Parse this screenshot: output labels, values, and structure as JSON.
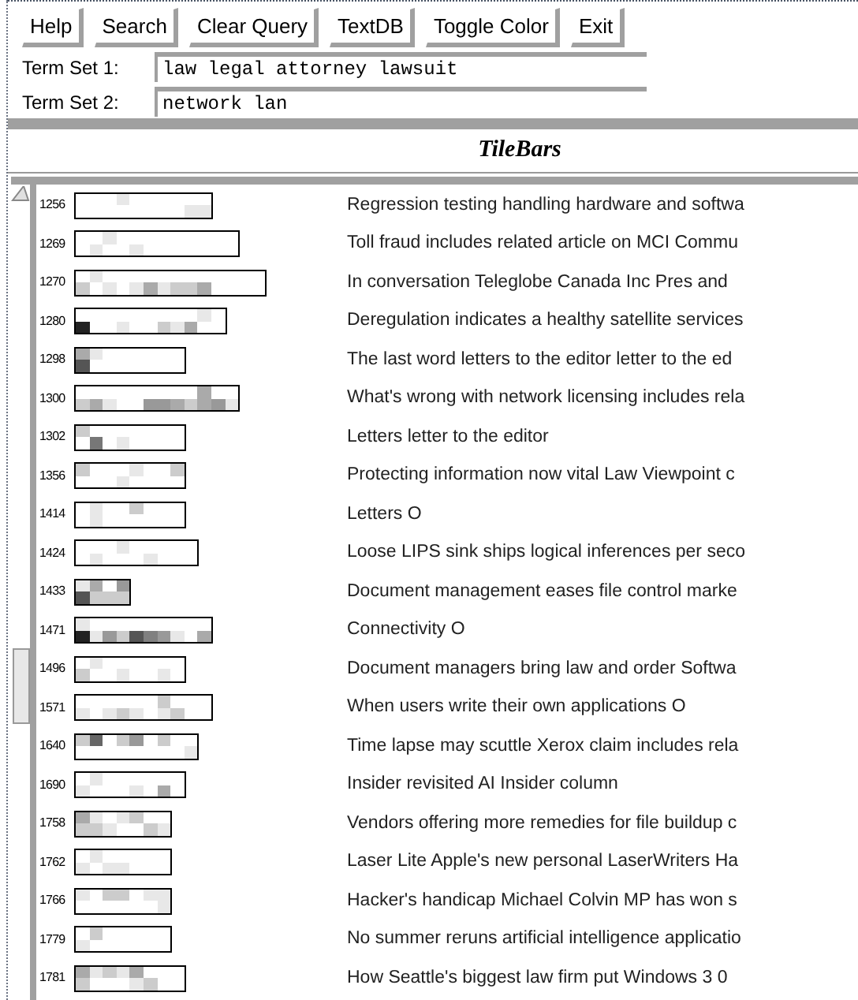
{
  "toolbar": {
    "buttons": [
      "Help",
      "Search",
      "Clear Query",
      "TextDB",
      "Toggle Color",
      "Exit"
    ]
  },
  "query": [
    {
      "label": "Term Set 1:",
      "value": "law legal attorney lawsuit"
    },
    {
      "label": "Term Set 2:",
      "value": "network lan"
    }
  ],
  "panel_title": "TileBars",
  "docs": [
    {
      "id": "1256",
      "title": "Regression testing handling hardware and softwa",
      "tiles": [
        [
          {
            "color": "#ffffff"
          },
          {
            "color": "#ffffff"
          },
          {
            "color": "#ffffff"
          },
          {
            "color": "#e8e8e8"
          },
          {
            "color": "#ffffff"
          },
          {
            "color": "#ffffff"
          },
          {
            "color": "#ffffff"
          },
          {
            "color": "#ffffff"
          },
          {
            "color": "#ffffff"
          },
          {
            "color": "#ffffff"
          }
        ],
        [
          {
            "color": "#ffffff"
          },
          {
            "color": "#ffffff"
          },
          {
            "color": "#ffffff"
          },
          {
            "color": "#ffffff"
          },
          {
            "color": "#ffffff"
          },
          {
            "color": "#ffffff"
          },
          {
            "color": "#ffffff"
          },
          {
            "color": "#ffffff"
          },
          {
            "color": "#e8e8e8"
          },
          {
            "color": "#e8e8e8"
          }
        ]
      ]
    },
    {
      "id": "1269",
      "title": "Toll fraud includes related article on MCI Commu",
      "tiles": [
        [
          {
            "color": "#ffffff"
          },
          {
            "color": "#ffffff"
          },
          {
            "color": "#e8e8e8"
          },
          {
            "color": "#ffffff"
          },
          {
            "color": "#ffffff"
          },
          {
            "color": "#ffffff"
          },
          {
            "color": "#ffffff"
          },
          {
            "color": "#ffffff"
          },
          {
            "color": "#ffffff"
          },
          {
            "color": "#ffffff"
          },
          {
            "color": "#ffffff"
          },
          {
            "color": "#ffffff"
          }
        ],
        [
          {
            "color": "#ffffff"
          },
          {
            "color": "#e8e8e8"
          },
          {
            "color": "#ffffff"
          },
          {
            "color": "#ffffff"
          },
          {
            "color": "#e8e8e8"
          },
          {
            "color": "#ffffff"
          },
          {
            "color": "#ffffff"
          },
          {
            "color": "#ffffff"
          },
          {
            "color": "#ffffff"
          },
          {
            "color": "#ffffff"
          },
          {
            "color": "#ffffff"
          },
          {
            "color": "#ffffff"
          }
        ]
      ]
    },
    {
      "id": "1270",
      "title": "In conversation Teleglobe Canada Inc Pres and",
      "tiles": [
        [
          {
            "color": "#ffffff"
          },
          {
            "color": "#e8e8e8"
          },
          {
            "color": "#ffffff"
          },
          {
            "color": "#ffffff"
          },
          {
            "color": "#ffffff"
          },
          {
            "color": "#ffffff"
          },
          {
            "color": "#ffffff"
          },
          {
            "color": "#ffffff"
          },
          {
            "color": "#ffffff"
          },
          {
            "color": "#ffffff"
          },
          {
            "color": "#ffffff"
          },
          {
            "color": "#ffffff"
          },
          {
            "color": "#ffffff"
          },
          {
            "color": "#ffffff"
          }
        ],
        [
          {
            "color": "#cccccc"
          },
          {
            "color": "#ffffff"
          },
          {
            "color": "#e8e8e8"
          },
          {
            "color": "#ffffff"
          },
          {
            "color": "#e8e8e8"
          },
          {
            "color": "#aaaaaa"
          },
          {
            "color": "#e8e8e8"
          },
          {
            "color": "#cccccc"
          },
          {
            "color": "#cccccc"
          },
          {
            "color": "#aaaaaa"
          },
          {
            "color": "#ffffff"
          },
          {
            "color": "#ffffff"
          },
          {
            "color": "#ffffff"
          },
          {
            "color": "#ffffff"
          }
        ]
      ]
    },
    {
      "id": "1280",
      "title": "Deregulation indicates a healthy satellite services",
      "tiles": [
        [
          {
            "color": "#ffffff"
          },
          {
            "color": "#ffffff"
          },
          {
            "color": "#ffffff"
          },
          {
            "color": "#ffffff"
          },
          {
            "color": "#ffffff"
          },
          {
            "color": "#ffffff"
          },
          {
            "color": "#ffffff"
          },
          {
            "color": "#ffffff"
          },
          {
            "color": "#ffffff"
          },
          {
            "color": "#e8e8e8"
          },
          {
            "color": "#ffffff"
          }
        ],
        [
          {
            "color": "#222222"
          },
          {
            "color": "#ffffff"
          },
          {
            "color": "#ffffff"
          },
          {
            "color": "#e8e8e8"
          },
          {
            "color": "#ffffff"
          },
          {
            "color": "#ffffff"
          },
          {
            "color": "#cccccc"
          },
          {
            "color": "#e8e8e8"
          },
          {
            "color": "#aaaaaa"
          },
          {
            "color": "#ffffff"
          },
          {
            "color": "#ffffff"
          }
        ]
      ]
    },
    {
      "id": "1298",
      "title": "The last word letters to the editor letter to the ed",
      "tiles": [
        [
          {
            "color": "#aaaaaa"
          },
          {
            "color": "#e8e8e8"
          },
          {
            "color": "#ffffff"
          },
          {
            "color": "#ffffff"
          },
          {
            "color": "#ffffff"
          },
          {
            "color": "#ffffff"
          },
          {
            "color": "#ffffff"
          },
          {
            "color": "#ffffff"
          }
        ],
        [
          {
            "color": "#555555"
          },
          {
            "color": "#ffffff"
          },
          {
            "color": "#ffffff"
          },
          {
            "color": "#ffffff"
          },
          {
            "color": "#ffffff"
          },
          {
            "color": "#ffffff"
          },
          {
            "color": "#ffffff"
          },
          {
            "color": "#ffffff"
          }
        ]
      ]
    },
    {
      "id": "1300",
      "title": "What's wrong with network licensing includes rela",
      "tiles": [
        [
          {
            "color": "#ffffff"
          },
          {
            "color": "#ffffff"
          },
          {
            "color": "#ffffff"
          },
          {
            "color": "#ffffff"
          },
          {
            "color": "#ffffff"
          },
          {
            "color": "#ffffff"
          },
          {
            "color": "#ffffff"
          },
          {
            "color": "#ffffff"
          },
          {
            "color": "#ffffff"
          },
          {
            "color": "#aaaaaa"
          },
          {
            "color": "#ffffff"
          },
          {
            "color": "#ffffff"
          }
        ],
        [
          {
            "color": "#cccccc"
          },
          {
            "color": "#aaaaaa"
          },
          {
            "color": "#e8e8e8"
          },
          {
            "color": "#ffffff"
          },
          {
            "color": "#ffffff"
          },
          {
            "color": "#999999"
          },
          {
            "color": "#999999"
          },
          {
            "color": "#aaaaaa"
          },
          {
            "color": "#cccccc"
          },
          {
            "color": "#aaaaaa"
          },
          {
            "color": "#999999"
          },
          {
            "color": "#e8e8e8"
          }
        ]
      ]
    },
    {
      "id": "1302",
      "title": "Letters letter to the editor",
      "tiles": [
        [
          {
            "color": "#cccccc"
          },
          {
            "color": "#ffffff"
          },
          {
            "color": "#ffffff"
          },
          {
            "color": "#ffffff"
          },
          {
            "color": "#ffffff"
          },
          {
            "color": "#ffffff"
          },
          {
            "color": "#ffffff"
          },
          {
            "color": "#ffffff"
          }
        ],
        [
          {
            "color": "#ffffff"
          },
          {
            "color": "#777777"
          },
          {
            "color": "#ffffff"
          },
          {
            "color": "#e8e8e8"
          },
          {
            "color": "#ffffff"
          },
          {
            "color": "#ffffff"
          },
          {
            "color": "#ffffff"
          },
          {
            "color": "#ffffff"
          }
        ]
      ]
    },
    {
      "id": "1356",
      "title": "Protecting information now vital Law Viewpoint c",
      "tiles": [
        [
          {
            "color": "#cccccc"
          },
          {
            "color": "#ffffff"
          },
          {
            "color": "#ffffff"
          },
          {
            "color": "#ffffff"
          },
          {
            "color": "#e8e8e8"
          },
          {
            "color": "#ffffff"
          },
          {
            "color": "#ffffff"
          },
          {
            "color": "#cccccc"
          }
        ],
        [
          {
            "color": "#ffffff"
          },
          {
            "color": "#ffffff"
          },
          {
            "color": "#ffffff"
          },
          {
            "color": "#e8e8e8"
          },
          {
            "color": "#ffffff"
          },
          {
            "color": "#ffffff"
          },
          {
            "color": "#ffffff"
          },
          {
            "color": "#ffffff"
          }
        ]
      ]
    },
    {
      "id": "1414",
      "title": "Letters O",
      "tiles": [
        [
          {
            "color": "#ffffff"
          },
          {
            "color": "#e8e8e8"
          },
          {
            "color": "#ffffff"
          },
          {
            "color": "#ffffff"
          },
          {
            "color": "#cccccc"
          },
          {
            "color": "#ffffff"
          },
          {
            "color": "#ffffff"
          },
          {
            "color": "#ffffff"
          }
        ],
        [
          {
            "color": "#ffffff"
          },
          {
            "color": "#e8e8e8"
          },
          {
            "color": "#ffffff"
          },
          {
            "color": "#ffffff"
          },
          {
            "color": "#ffffff"
          },
          {
            "color": "#ffffff"
          },
          {
            "color": "#ffffff"
          },
          {
            "color": "#ffffff"
          }
        ]
      ]
    },
    {
      "id": "1424",
      "title": "Loose LIPS sink ships logical inferences per seco",
      "tiles": [
        [
          {
            "color": "#ffffff"
          },
          {
            "color": "#ffffff"
          },
          {
            "color": "#ffffff"
          },
          {
            "color": "#e8e8e8"
          },
          {
            "color": "#ffffff"
          },
          {
            "color": "#ffffff"
          },
          {
            "color": "#ffffff"
          },
          {
            "color": "#ffffff"
          },
          {
            "color": "#ffffff"
          }
        ],
        [
          {
            "color": "#ffffff"
          },
          {
            "color": "#e8e8e8"
          },
          {
            "color": "#ffffff"
          },
          {
            "color": "#ffffff"
          },
          {
            "color": "#ffffff"
          },
          {
            "color": "#e8e8e8"
          },
          {
            "color": "#ffffff"
          },
          {
            "color": "#ffffff"
          },
          {
            "color": "#ffffff"
          }
        ]
      ]
    },
    {
      "id": "1433",
      "title": "Document management eases file control marke",
      "tiles": [
        [
          {
            "color": "#e8e8e8"
          },
          {
            "color": "#aaaaaa"
          },
          {
            "color": "#ffffff"
          },
          {
            "color": "#999999"
          }
        ],
        [
          {
            "color": "#555555"
          },
          {
            "color": "#cccccc"
          },
          {
            "color": "#cccccc"
          },
          {
            "color": "#cccccc"
          }
        ]
      ]
    },
    {
      "id": "1471",
      "title": "Connectivity O",
      "tiles": [
        [
          {
            "color": "#e8e8e8"
          },
          {
            "color": "#ffffff"
          },
          {
            "color": "#ffffff"
          },
          {
            "color": "#ffffff"
          },
          {
            "color": "#ffffff"
          },
          {
            "color": "#ffffff"
          },
          {
            "color": "#ffffff"
          },
          {
            "color": "#ffffff"
          },
          {
            "color": "#ffffff"
          },
          {
            "color": "#ffffff"
          }
        ],
        [
          {
            "color": "#222222"
          },
          {
            "color": "#e8e8e8"
          },
          {
            "color": "#999999"
          },
          {
            "color": "#cccccc"
          },
          {
            "color": "#555555"
          },
          {
            "color": "#808080"
          },
          {
            "color": "#999999"
          },
          {
            "color": "#e8e8e8"
          },
          {
            "color": "#ffffff"
          },
          {
            "color": "#aaaaaa"
          }
        ]
      ]
    },
    {
      "id": "1496",
      "title": "Document managers bring law and order Softwa",
      "tiles": [
        [
          {
            "color": "#ffffff"
          },
          {
            "color": "#e8e8e8"
          },
          {
            "color": "#ffffff"
          },
          {
            "color": "#ffffff"
          },
          {
            "color": "#ffffff"
          },
          {
            "color": "#ffffff"
          },
          {
            "color": "#ffffff"
          },
          {
            "color": "#ffffff"
          }
        ],
        [
          {
            "color": "#cccccc"
          },
          {
            "color": "#ffffff"
          },
          {
            "color": "#ffffff"
          },
          {
            "color": "#e8e8e8"
          },
          {
            "color": "#ffffff"
          },
          {
            "color": "#ffffff"
          },
          {
            "color": "#e8e8e8"
          },
          {
            "color": "#ffffff"
          }
        ]
      ]
    },
    {
      "id": "1571",
      "title": "When users write their own applications O",
      "tiles": [
        [
          {
            "color": "#ffffff"
          },
          {
            "color": "#ffffff"
          },
          {
            "color": "#ffffff"
          },
          {
            "color": "#ffffff"
          },
          {
            "color": "#ffffff"
          },
          {
            "color": "#ffffff"
          },
          {
            "color": "#cccccc"
          },
          {
            "color": "#ffffff"
          },
          {
            "color": "#ffffff"
          },
          {
            "color": "#ffffff"
          }
        ],
        [
          {
            "color": "#e8e8e8"
          },
          {
            "color": "#ffffff"
          },
          {
            "color": "#e8e8e8"
          },
          {
            "color": "#cccccc"
          },
          {
            "color": "#e8e8e8"
          },
          {
            "color": "#ffffff"
          },
          {
            "color": "#e8e8e8"
          },
          {
            "color": "#cccccc"
          },
          {
            "color": "#ffffff"
          },
          {
            "color": "#ffffff"
          }
        ]
      ]
    },
    {
      "id": "1640",
      "title": "Time lapse may scuttle Xerox claim includes rela",
      "tiles": [
        [
          {
            "color": "#cccccc"
          },
          {
            "color": "#666666"
          },
          {
            "color": "#ffffff"
          },
          {
            "color": "#cccccc"
          },
          {
            "color": "#999999"
          },
          {
            "color": "#ffffff"
          },
          {
            "color": "#cccccc"
          },
          {
            "color": "#ffffff"
          },
          {
            "color": "#ffffff"
          }
        ],
        [
          {
            "color": "#ffffff"
          },
          {
            "color": "#ffffff"
          },
          {
            "color": "#ffffff"
          },
          {
            "color": "#ffffff"
          },
          {
            "color": "#ffffff"
          },
          {
            "color": "#ffffff"
          },
          {
            "color": "#ffffff"
          },
          {
            "color": "#ffffff"
          },
          {
            "color": "#e8e8e8"
          }
        ]
      ]
    },
    {
      "id": "1690",
      "title": "Insider revisited AI Insider column",
      "tiles": [
        [
          {
            "color": "#ffffff"
          },
          {
            "color": "#e8e8e8"
          },
          {
            "color": "#ffffff"
          },
          {
            "color": "#ffffff"
          },
          {
            "color": "#ffffff"
          },
          {
            "color": "#ffffff"
          },
          {
            "color": "#ffffff"
          },
          {
            "color": "#ffffff"
          }
        ],
        [
          {
            "color": "#e8e8e8"
          },
          {
            "color": "#ffffff"
          },
          {
            "color": "#ffffff"
          },
          {
            "color": "#ffffff"
          },
          {
            "color": "#e8e8e8"
          },
          {
            "color": "#ffffff"
          },
          {
            "color": "#aaaaaa"
          },
          {
            "color": "#ffffff"
          }
        ]
      ]
    },
    {
      "id": "1758",
      "title": "Vendors offering more remedies for file buildup c",
      "tiles": [
        [
          {
            "color": "#aaaaaa"
          },
          {
            "color": "#e8e8e8"
          },
          {
            "color": "#ffffff"
          },
          {
            "color": "#e8e8e8"
          },
          {
            "color": "#cccccc"
          },
          {
            "color": "#ffffff"
          },
          {
            "color": "#ffffff"
          }
        ],
        [
          {
            "color": "#cccccc"
          },
          {
            "color": "#cccccc"
          },
          {
            "color": "#e8e8e8"
          },
          {
            "color": "#ffffff"
          },
          {
            "color": "#ffffff"
          },
          {
            "color": "#cccccc"
          },
          {
            "color": "#e8e8e8"
          }
        ]
      ]
    },
    {
      "id": "1762",
      "title": "Laser Lite Apple's new personal LaserWriters Ha",
      "tiles": [
        [
          {
            "color": "#ffffff"
          },
          {
            "color": "#e8e8e8"
          },
          {
            "color": "#ffffff"
          },
          {
            "color": "#ffffff"
          },
          {
            "color": "#ffffff"
          },
          {
            "color": "#ffffff"
          },
          {
            "color": "#ffffff"
          }
        ],
        [
          {
            "color": "#e8e8e8"
          },
          {
            "color": "#ffffff"
          },
          {
            "color": "#e8e8e8"
          },
          {
            "color": "#e8e8e8"
          },
          {
            "color": "#ffffff"
          },
          {
            "color": "#ffffff"
          },
          {
            "color": "#ffffff"
          }
        ]
      ]
    },
    {
      "id": "1766",
      "title": "Hacker's handicap Michael Colvin MP has won s",
      "tiles": [
        [
          {
            "color": "#e8e8e8"
          },
          {
            "color": "#ffffff"
          },
          {
            "color": "#cccccc"
          },
          {
            "color": "#cccccc"
          },
          {
            "color": "#ffffff"
          },
          {
            "color": "#e8e8e8"
          },
          {
            "color": "#e8e8e8"
          }
        ],
        [
          {
            "color": "#ffffff"
          },
          {
            "color": "#ffffff"
          },
          {
            "color": "#ffffff"
          },
          {
            "color": "#ffffff"
          },
          {
            "color": "#ffffff"
          },
          {
            "color": "#ffffff"
          },
          {
            "color": "#e8e8e8"
          }
        ]
      ]
    },
    {
      "id": "1779",
      "title": "No summer reruns artificial intelligence applicatio",
      "tiles": [
        [
          {
            "color": "#ffffff"
          },
          {
            "color": "#cccccc"
          },
          {
            "color": "#ffffff"
          },
          {
            "color": "#ffffff"
          },
          {
            "color": "#ffffff"
          },
          {
            "color": "#ffffff"
          },
          {
            "color": "#ffffff"
          }
        ],
        [
          {
            "color": "#e8e8e8"
          },
          {
            "color": "#ffffff"
          },
          {
            "color": "#ffffff"
          },
          {
            "color": "#ffffff"
          },
          {
            "color": "#ffffff"
          },
          {
            "color": "#ffffff"
          },
          {
            "color": "#ffffff"
          }
        ]
      ]
    },
    {
      "id": "1781",
      "title": "How Seattle's biggest law firm put Windows 3 0",
      "tiles": [
        [
          {
            "color": "#aaaaaa"
          },
          {
            "color": "#e8e8e8"
          },
          {
            "color": "#cccccc"
          },
          {
            "color": "#e8e8e8"
          },
          {
            "color": "#aaaaaa"
          },
          {
            "color": "#ffffff"
          },
          {
            "color": "#ffffff"
          },
          {
            "color": "#ffffff"
          }
        ],
        [
          {
            "color": "#cccccc"
          },
          {
            "color": "#ffffff"
          },
          {
            "color": "#ffffff"
          },
          {
            "color": "#ffffff"
          },
          {
            "color": "#e8e8e8"
          },
          {
            "color": "#cccccc"
          },
          {
            "color": "#ffffff"
          },
          {
            "color": "#ffffff"
          }
        ]
      ]
    }
  ]
}
